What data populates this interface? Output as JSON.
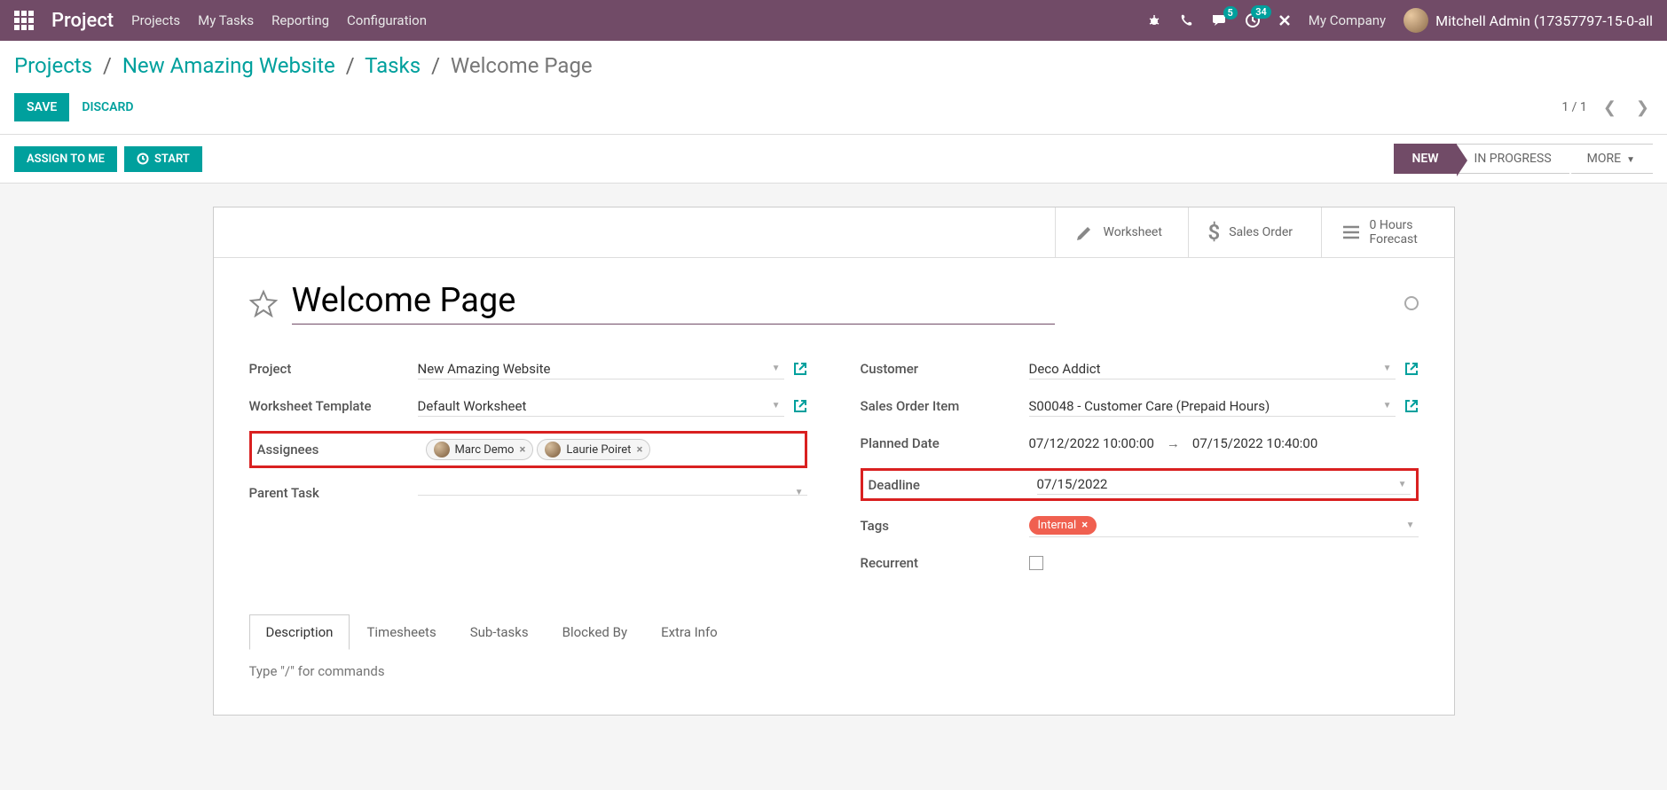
{
  "nav": {
    "brand": "Project",
    "links": [
      "Projects",
      "My Tasks",
      "Reporting",
      "Configuration"
    ],
    "chat_badge": "5",
    "activity_badge": "34",
    "company": "My Company",
    "user": "Mitchell Admin (17357797-15-0-all"
  },
  "breadcrumb": {
    "l1": "Projects",
    "l2": "New Amazing Website",
    "l3": "Tasks",
    "current": "Welcome Page"
  },
  "actions": {
    "save": "SAVE",
    "discard": "DISCARD",
    "pager": "1 / 1",
    "assign": "ASSIGN TO ME",
    "start": "START"
  },
  "stages": {
    "new": "NEW",
    "in_progress": "IN PROGRESS",
    "more": "MORE"
  },
  "smart": {
    "worksheet": "Worksheet",
    "sales_order": "Sales Order",
    "hours_l1": "0  Hours",
    "hours_l2": "Forecast"
  },
  "task": {
    "title": "Welcome Page"
  },
  "left": {
    "project_label": "Project",
    "project_value": "New Amazing Website",
    "wt_label": "Worksheet Template",
    "wt_value": "Default Worksheet",
    "assignees_label": "Assignees",
    "assignee1": "Marc Demo",
    "assignee2": "Laurie Poiret",
    "parent_label": "Parent Task"
  },
  "right": {
    "customer_label": "Customer",
    "customer_value": "Deco Addict",
    "soi_label": "Sales Order Item",
    "soi_value": "S00048 - Customer Care (Prepaid Hours)",
    "planned_label": "Planned Date",
    "planned_from": "07/12/2022 10:00:00",
    "planned_to": "07/15/2022 10:40:00",
    "deadline_label": "Deadline",
    "deadline_value": "07/15/2022",
    "tags_label": "Tags",
    "tag1": "Internal",
    "recurrent_label": "Recurrent"
  },
  "tabs": {
    "desc": "Description",
    "timesheets": "Timesheets",
    "subtasks": "Sub-tasks",
    "blocked": "Blocked By",
    "extra": "Extra Info",
    "placeholder": "Type \"/\" for commands"
  }
}
